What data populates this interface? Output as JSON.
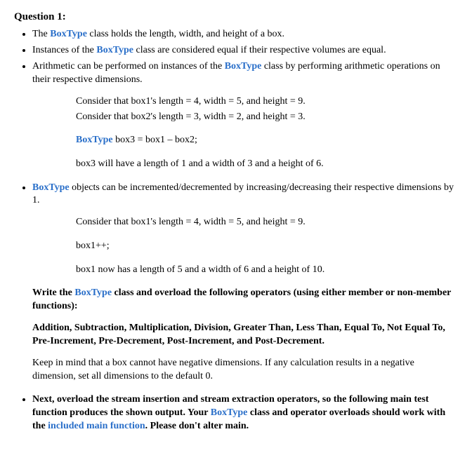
{
  "title": "Question 1:",
  "bullets": {
    "b1_pre": "The ",
    "b1_kw": "BoxType",
    "b1_post": " class holds the length, width, and height of a box.",
    "b2_pre": "Instances of the ",
    "b2_kw": "BoxType",
    "b2_post": " class are considered equal if their respective volumes are equal.",
    "b3_pre": "Arithmetic can be performed on instances of the ",
    "b3_kw": "BoxType",
    "b3_post": " class by performing arithmetic operations on their respective dimensions.",
    "b4_kw": "BoxType",
    "b4_post": " objects can be incremented/decremented by increasing/decreasing their respective dimensions by 1.",
    "b5_pre": "Next, overload the stream insertion and stream extraction operators, so the following main test function produces the shown output.  Your ",
    "b5_kw": "BoxType",
    "b5_mid": " class and operator overloads should work with the ",
    "b5_link": "included main function",
    "b5_post": ".  Please don't alter main."
  },
  "code1": {
    "l1": "Consider that box1's length = 4, width = 5, and height = 9.",
    "l2": "Consider that box2's length = 3, width = 2, and height = 3.",
    "l3_kw": "BoxType",
    "l3_post": " box3 = box1 – box2;",
    "l4": "box3 will have a length of 1 and a width of 3 and a height of 6."
  },
  "code2": {
    "l1": "Consider that box1's length = 4, width = 5, and height = 9.",
    "l2": "box1++;",
    "l3": "box1 now has a length of 5 and a width of 6 and a height of 10."
  },
  "instr": {
    "write_pre": "Write the ",
    "write_kw": "BoxType",
    "write_post": " class and overload the following operators (using either member or non-member functions):",
    "ops": "Addition, Subtraction, Multiplication, Division, Greater Than, Less Than, Equal To, Not Equal To, Pre-Increment, Pre-Decrement, Post-Increment, and Post-Decrement.",
    "neg": "Keep in mind that a box cannot have negative dimensions.  If any calculation results in a negative dimension, set all dimensions to the default 0."
  }
}
